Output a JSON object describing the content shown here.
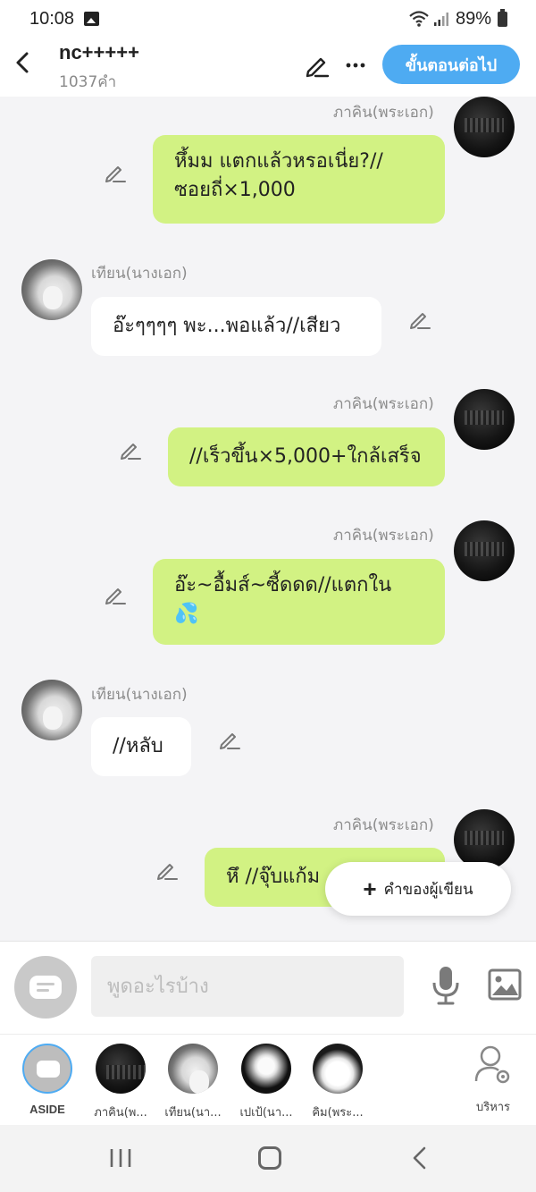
{
  "status_bar": {
    "time": "10:08",
    "battery": "89%"
  },
  "header": {
    "title": "nc+++++",
    "word_count": "1037คำ",
    "next_button": "ขั้นตอนต่อไป"
  },
  "messages": [
    {
      "speaker": "ภาคิน(พระเอก)",
      "side": "right",
      "text_lines": [
        "หึ้มม แตกแล้วหรอเนี่ย?//",
        "ซอยถี่×1,000"
      ]
    },
    {
      "speaker": "เทียน(นางเอก)",
      "side": "left",
      "text_lines": [
        "อ๊ะๆๆๆๆ พะ...พอแล้ว//เสียว"
      ]
    },
    {
      "speaker": "ภาคิน(พระเอก)",
      "side": "right",
      "text_lines": [
        "//เร็วขึ้น×5,000+ใกล้เสร็จ"
      ]
    },
    {
      "speaker": "ภาคิน(พระเอก)",
      "side": "right",
      "text_lines": [
        "อ๊ะ~อื้มส์~ซี้ดดด//แตกใน",
        "💦"
      ]
    },
    {
      "speaker": "เทียน(นางเอก)",
      "side": "left",
      "text_lines": [
        "//หลับ"
      ]
    },
    {
      "speaker": "ภาคิน(พระเอก)",
      "side": "right",
      "text_lines": [
        "หึ //จุ๊บแก้ม"
      ]
    }
  ],
  "fab": {
    "label": "คำของผู้เขียน"
  },
  "input": {
    "placeholder": "พูดอะไรบ้าง"
  },
  "characters": [
    {
      "label": "ASIDE"
    },
    {
      "label": "ภาคิน(พ..."
    },
    {
      "label": "เทียน(นา..."
    },
    {
      "label": "เปเป้(นา..."
    },
    {
      "label": "คิม(พระ..."
    }
  ],
  "manage": {
    "label": "บริหาร"
  },
  "colors": {
    "accent": "#4eabf2",
    "bubble_green": "#d2f283",
    "bubble_white": "#ffffff"
  }
}
